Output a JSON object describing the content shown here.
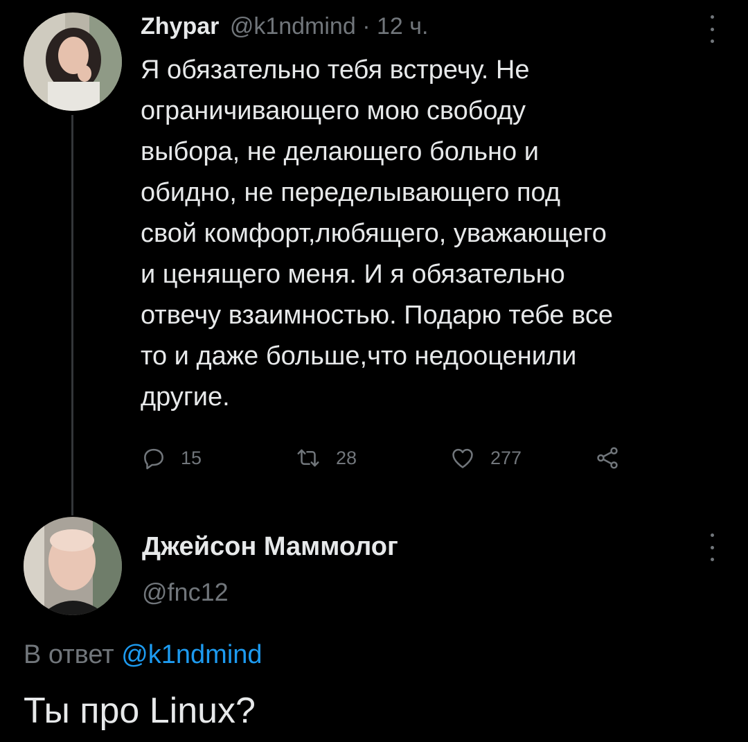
{
  "tweet1": {
    "display_name": "Zhypar",
    "handle": "@k1ndmind",
    "separator": " · ",
    "time": "12 ч.",
    "lines": [
      "Я обязательно тебя встречу. Не",
      "ограничивающего мою свободу",
      "выбора, не делающего больно и",
      "обидно, не переделывающего под",
      "свой комфорт,любящего, уважающего",
      "и ценящего меня. И я обязательно",
      "отвечу взаимностью. Подарю тебе все",
      "то и даже больше,что недооценили",
      "другие."
    ],
    "actions": {
      "replies": "15",
      "retweets": "28",
      "likes": "277"
    },
    "icons": {
      "reply": "reply-icon",
      "retweet": "retweet-icon",
      "like": "heart-icon",
      "share": "share-icon",
      "more": "more-vertical-icon"
    }
  },
  "tweet2": {
    "display_name": "Джейсон Маммолог",
    "handle": "@fnc12",
    "reply_prefix": "В ответ ",
    "reply_mention": "@k1ndmind",
    "text": "Ты про Linux?"
  },
  "colors": {
    "background": "#000000",
    "text": "#e7e9ea",
    "muted": "#71767b",
    "accent": "#1d9bf0",
    "thread_line": "#333639"
  }
}
